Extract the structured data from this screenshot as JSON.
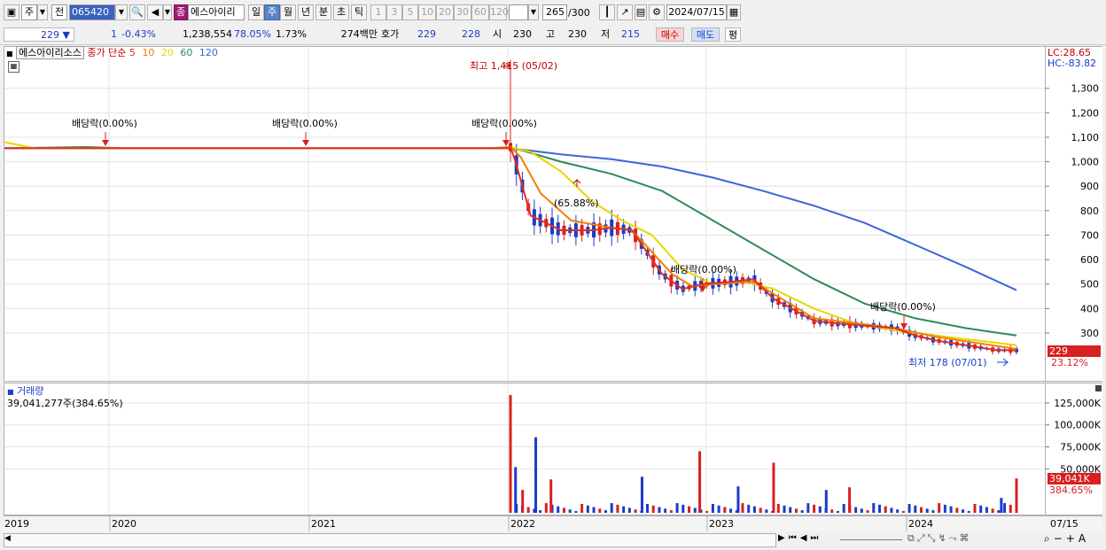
{
  "toolbar": {
    "period_label": "주",
    "prev_label": "전",
    "code": "065420",
    "name": "에스아이리",
    "name_badge": "종",
    "periods": [
      "일",
      "주",
      "월",
      "년",
      "분",
      "초",
      "틱"
    ],
    "active_period": "주",
    "minute_steps": [
      "1",
      "3",
      "5",
      "10",
      "20",
      "30",
      "60",
      "120"
    ],
    "count": "265",
    "count_total": "/300",
    "date": "2024/07/15"
  },
  "quote": {
    "price": "229",
    "change": "1",
    "change_pct": "-0.43%",
    "volume": "1,238,554",
    "ratio": "78.05%",
    "turnover": "1.73%",
    "amount": "274백만",
    "hoga_label": "호가",
    "bid": "229",
    "ask": "228",
    "open_label": "시",
    "open": "230",
    "high_label": "고",
    "high": "230",
    "low_label": "저",
    "low": "215",
    "buy_label": "매수",
    "sell_label": "매도",
    "pyeong_label": "평"
  },
  "legend": {
    "name": "에스아이리소스",
    "type": "종가 단순",
    "periods": [
      "5",
      "10",
      "20",
      "60",
      "120"
    ],
    "colors": {
      "5": "#e03020",
      "10": "#f08000",
      "20": "#e6d800",
      "60": "#2e8b57",
      "120": "#3a66d8"
    }
  },
  "axis_info": {
    "lc": "LC:28.65",
    "hc": "HC:-83.82"
  },
  "price_badge": {
    "value": "229",
    "pct": "23.12%"
  },
  "volume_panel": {
    "title": "거래량",
    "summary": "39,041,277주(384.65%)",
    "badge": "39,041K",
    "badge_pct": "384.65%"
  },
  "annotations": {
    "high": "최고 1,415 (05/02)",
    "low": "최저 178 (07/01)",
    "drop": "(65.88%)",
    "dividends": [
      "배당락(0.00%)",
      "배당락(0.00%)",
      "배당락(0.00%)",
      "배당락(0.00%)",
      "배당락(0.00%)"
    ]
  },
  "chart_data": {
    "type": "line",
    "title": "",
    "price_ticks": [
      300,
      400,
      500,
      600,
      700,
      800,
      900,
      1000,
      1100,
      1200,
      1300
    ],
    "price_tick_labels": [
      "300",
      "400",
      "500",
      "600",
      "700",
      "800",
      "900",
      "1,000",
      "1,100",
      "1,200",
      "1,300"
    ],
    "volume_ticks": [
      50000,
      75000,
      100000,
      125000
    ],
    "volume_tick_labels": [
      "50,000K",
      "75,000K",
      "100,000K",
      "125,000K"
    ],
    "x_labels": [
      "2019",
      "2020",
      "2021",
      "2022",
      "2023",
      "2024",
      "07/15"
    ],
    "series": [
      {
        "name": "5",
        "x": [
          0,
          0.05,
          0.48,
          0.498,
          0.5,
          0.505,
          0.52,
          0.55,
          0.58,
          0.6,
          0.62,
          0.65,
          0.67,
          0.69,
          0.72,
          0.74,
          0.76,
          0.8,
          0.82,
          0.85,
          0.88,
          0.9,
          0.92,
          0.95,
          0.98,
          1.0
        ],
        "y": [
          1055,
          1055,
          1055,
          1055,
          1060,
          1000,
          780,
          720,
          720,
          730,
          720,
          540,
          480,
          500,
          510,
          520,
          440,
          350,
          340,
          330,
          320,
          290,
          270,
          250,
          230,
          229
        ]
      },
      {
        "name": "10",
        "x": [
          0,
          0.48,
          0.5,
          0.51,
          0.53,
          0.56,
          0.6,
          0.62,
          0.66,
          0.68,
          0.7,
          0.74,
          0.76,
          0.8,
          0.84,
          0.88,
          0.92,
          0.96,
          1.0
        ],
        "y": [
          1055,
          1055,
          1060,
          1020,
          870,
          760,
          730,
          720,
          540,
          490,
          500,
          510,
          460,
          360,
          340,
          320,
          285,
          260,
          235
        ]
      },
      {
        "name": "20",
        "x": [
          0,
          0.03,
          0.05,
          0.48,
          0.5,
          0.52,
          0.55,
          0.58,
          0.61,
          0.64,
          0.67,
          0.7,
          0.73,
          0.76,
          0.8,
          0.84,
          0.88,
          0.92,
          0.96,
          1.0
        ],
        "y": [
          1080,
          1055,
          1055,
          1055,
          1060,
          1040,
          960,
          840,
          760,
          700,
          560,
          500,
          510,
          480,
          400,
          340,
          310,
          290,
          270,
          250
        ]
      },
      {
        "name": "60",
        "x": [
          0,
          0.08,
          0.12,
          0.48,
          0.5,
          0.55,
          0.6,
          0.65,
          0.7,
          0.75,
          0.8,
          0.85,
          0.9,
          0.95,
          1.0
        ],
        "y": [
          1055,
          1060,
          1055,
          1055,
          1060,
          1000,
          950,
          880,
          760,
          640,
          520,
          420,
          360,
          320,
          290
        ]
      },
      {
        "name": "120",
        "x": [
          0,
          0.5,
          0.55,
          0.6,
          0.65,
          0.7,
          0.75,
          0.8,
          0.85,
          0.9,
          0.95,
          1.0
        ],
        "y": [
          1055,
          1055,
          1030,
          1010,
          980,
          935,
          880,
          820,
          750,
          660,
          570,
          475
        ]
      }
    ],
    "candles": {
      "start_x": 0.5,
      "count": 86
    },
    "volume": {
      "x": [
        0.5,
        0.505,
        0.512,
        0.525,
        0.54,
        0.63,
        0.687,
        0.725,
        0.76,
        0.812,
        0.835,
        0.985,
        1.0
      ],
      "y": [
        134000,
        52000,
        26000,
        86000,
        38000,
        41000,
        70000,
        30000,
        57000,
        26000,
        29000,
        17000,
        39041
      ]
    }
  }
}
